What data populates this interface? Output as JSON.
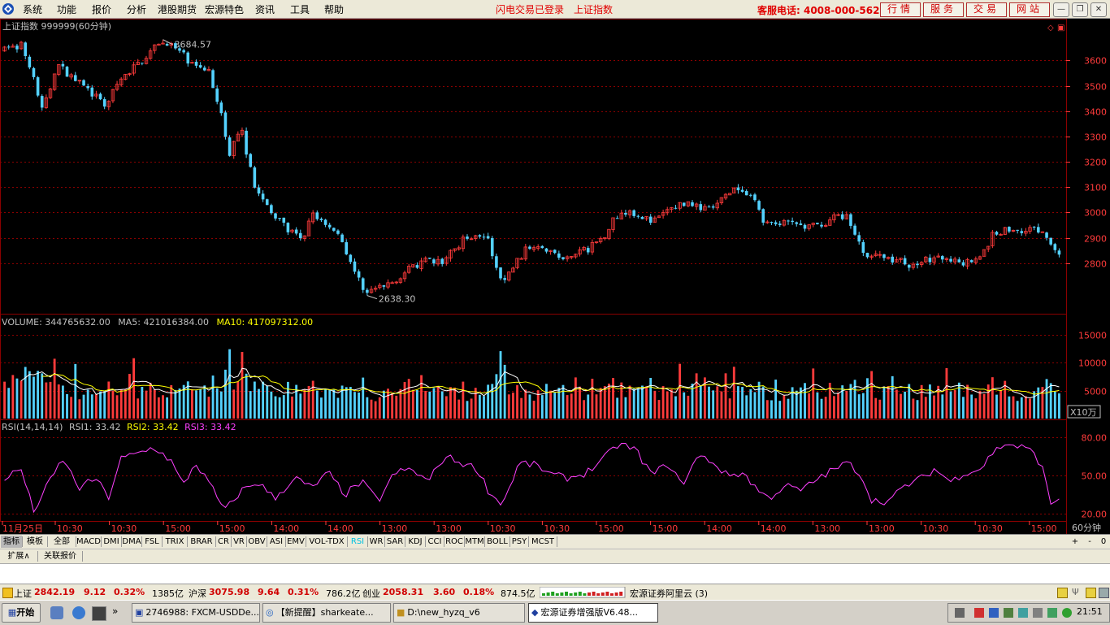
{
  "menu": {
    "items": [
      "系统",
      "功能",
      "报价",
      "分析",
      "港股期货",
      "宏源特色",
      "资讯",
      "工具",
      "帮助"
    ],
    "status_login": "闪电交易已登录",
    "status_index": "上证指数",
    "hotline": "客服电话: 4008-000-562",
    "buttons": [
      "行情",
      "服务",
      "交易",
      "网站"
    ],
    "window_controls": [
      "minimize-icon",
      "restore-icon",
      "close-icon"
    ]
  },
  "chart": {
    "header": "上证指数 999999(60分钟)",
    "high_label": "3684.57",
    "low_label": "2638.30",
    "volume_header": {
      "prefix": "VOLUME: 344765632.00",
      "ma5": "MA5: 421016384.00",
      "ma10": "MA10: 417097312.00"
    },
    "rsi_header": {
      "prefix": "RSI(14,14,14)",
      "rsi1": "RSI1: 33.42",
      "rsi2": "RSI2: 33.42",
      "rsi3": "RSI3: 33.42"
    },
    "volume_unit": "X10万",
    "period_label": "60分钟",
    "colors": {
      "up": "#ff3b3b",
      "down": "#54d2ff",
      "grid": "#8b0000",
      "ma5": "#ffffff",
      "ma10": "#ffff00",
      "rsi": "#ff40ff",
      "axis_text": "#ff3b3b"
    }
  },
  "chart_data": [
    {
      "type": "candlestick",
      "title": "上证指数 999999(60分钟)",
      "y_ticks": [
        2800,
        2900,
        3000,
        3100,
        3200,
        3300,
        3400,
        3500,
        3600
      ],
      "ylim": [
        2620,
        3710
      ],
      "high": 3684.57,
      "low": 2638.3,
      "trend_anchors": [
        [
          0,
          3640
        ],
        [
          8,
          3660
        ],
        [
          14,
          3540
        ],
        [
          18,
          3400
        ],
        [
          26,
          3580
        ],
        [
          33,
          3530
        ],
        [
          42,
          3470
        ],
        [
          48,
          3420
        ],
        [
          56,
          3520
        ],
        [
          66,
          3600
        ],
        [
          74,
          3660
        ],
        [
          78,
          3675
        ],
        [
          86,
          3620
        ],
        [
          92,
          3570
        ],
        [
          98,
          3570
        ],
        [
          104,
          3400
        ],
        [
          108,
          3230
        ],
        [
          114,
          3330
        ],
        [
          120,
          3110
        ],
        [
          128,
          3000
        ],
        [
          136,
          2940
        ],
        [
          144,
          2880
        ],
        [
          148,
          3000
        ],
        [
          154,
          2960
        ],
        [
          160,
          2930
        ],
        [
          164,
          2860
        ],
        [
          170,
          2740
        ],
        [
          174,
          2690
        ],
        [
          180,
          2700
        ],
        [
          186,
          2720
        ],
        [
          192,
          2760
        ],
        [
          198,
          2790
        ],
        [
          204,
          2810
        ],
        [
          210,
          2800
        ],
        [
          216,
          2850
        ],
        [
          222,
          2900
        ],
        [
          228,
          2920
        ],
        [
          233,
          2890
        ],
        [
          236,
          2790
        ],
        [
          240,
          2720
        ],
        [
          246,
          2800
        ],
        [
          252,
          2860
        ],
        [
          258,
          2880
        ],
        [
          264,
          2840
        ],
        [
          270,
          2810
        ],
        [
          276,
          2840
        ],
        [
          282,
          2860
        ],
        [
          288,
          2900
        ],
        [
          294,
          2980
        ],
        [
          300,
          3010
        ],
        [
          306,
          2990
        ],
        [
          312,
          2960
        ],
        [
          318,
          3000
        ],
        [
          324,
          3030
        ],
        [
          330,
          3040
        ],
        [
          336,
          3010
        ],
        [
          342,
          3020
        ],
        [
          348,
          3070
        ],
        [
          352,
          3090
        ],
        [
          356,
          3080
        ],
        [
          362,
          3040
        ],
        [
          366,
          2960
        ],
        [
          372,
          2950
        ],
        [
          380,
          2960
        ],
        [
          386,
          2940
        ],
        [
          392,
          2950
        ],
        [
          400,
          2980
        ],
        [
          406,
          2990
        ],
        [
          410,
          2900
        ],
        [
          414,
          2840
        ],
        [
          420,
          2830
        ],
        [
          426,
          2820
        ],
        [
          432,
          2810
        ],
        [
          436,
          2790
        ],
        [
          440,
          2800
        ],
        [
          446,
          2820
        ],
        [
          452,
          2810
        ],
        [
          458,
          2820
        ],
        [
          462,
          2800
        ],
        [
          468,
          2820
        ],
        [
          474,
          2860
        ],
        [
          476,
          2920
        ],
        [
          482,
          2930
        ],
        [
          488,
          2930
        ],
        [
          494,
          2940
        ],
        [
          500,
          2920
        ],
        [
          504,
          2880
        ],
        [
          508,
          2830
        ]
      ],
      "volume_y_ticks": [
        5000,
        10000,
        15000
      ],
      "volume_ylim": [
        0,
        16000
      ],
      "rsi_y_ticks": [
        20.0,
        50.0,
        80.0
      ],
      "rsi_ylim": [
        15,
        85
      ],
      "rsi_anchors": [
        [
          0,
          48
        ],
        [
          8,
          55
        ],
        [
          14,
          22
        ],
        [
          20,
          40
        ],
        [
          28,
          63
        ],
        [
          36,
          40
        ],
        [
          44,
          48
        ],
        [
          50,
          32
        ],
        [
          56,
          63
        ],
        [
          64,
          67
        ],
        [
          72,
          72
        ],
        [
          80,
          62
        ],
        [
          86,
          42
        ],
        [
          92,
          60
        ],
        [
          100,
          40
        ],
        [
          106,
          22
        ],
        [
          114,
          38
        ],
        [
          122,
          45
        ],
        [
          130,
          32
        ],
        [
          140,
          48
        ],
        [
          148,
          40
        ],
        [
          156,
          52
        ],
        [
          164,
          35
        ],
        [
          172,
          45
        ],
        [
          180,
          30
        ],
        [
          188,
          52
        ],
        [
          196,
          55
        ],
        [
          204,
          45
        ],
        [
          212,
          65
        ],
        [
          220,
          60
        ],
        [
          228,
          55
        ],
        [
          234,
          35
        ],
        [
          240,
          28
        ],
        [
          248,
          60
        ],
        [
          256,
          58
        ],
        [
          264,
          50
        ],
        [
          272,
          48
        ],
        [
          280,
          52
        ],
        [
          288,
          62
        ],
        [
          296,
          75
        ],
        [
          304,
          70
        ],
        [
          312,
          50
        ],
        [
          320,
          60
        ],
        [
          326,
          42
        ],
        [
          334,
          65
        ],
        [
          340,
          62
        ],
        [
          348,
          50
        ],
        [
          356,
          52
        ],
        [
          362,
          40
        ],
        [
          368,
          32
        ],
        [
          376,
          42
        ],
        [
          384,
          38
        ],
        [
          392,
          48
        ],
        [
          400,
          55
        ],
        [
          406,
          60
        ],
        [
          412,
          52
        ],
        [
          418,
          30
        ],
        [
          426,
          30
        ],
        [
          434,
          42
        ],
        [
          442,
          48
        ],
        [
          448,
          55
        ],
        [
          456,
          45
        ],
        [
          462,
          52
        ],
        [
          470,
          55
        ],
        [
          476,
          68
        ],
        [
          482,
          75
        ],
        [
          490,
          72
        ],
        [
          496,
          68
        ],
        [
          500,
          55
        ],
        [
          504,
          28
        ],
        [
          508,
          32
        ]
      ],
      "x_labels": [
        "11月25日",
        "10:30",
        "10:30",
        "15:00",
        "15:00",
        "14:00",
        "14:00",
        "13:00",
        "13:00",
        "10:30",
        "10:30",
        "15:00",
        "15:00",
        "14:00",
        "14:00",
        "13:00",
        "13:00",
        "10:30",
        "10:30",
        "15:00"
      ],
      "candle_count": 254
    }
  ],
  "tabs": {
    "items": [
      "指标",
      "模板",
      "全部",
      "MACD",
      "DMI",
      "DMA",
      "FSL",
      "TRIX",
      "BRAR",
      "CR",
      "VR",
      "OBV",
      "ASI",
      "EMV",
      "VOL-TDX",
      "RSI",
      "WR",
      "SAR",
      "KDJ",
      "CCI",
      "ROC",
      "MTM",
      "BOLL",
      "PSY",
      "MCST"
    ],
    "active": "RSI",
    "right_buttons": [
      "+",
      "-",
      "0"
    ]
  },
  "subtabs": {
    "items": [
      "扩展∧",
      "关联报价"
    ]
  },
  "statusbar": {
    "sh": {
      "name": "上证",
      "value": "2842.19",
      "change": "9.12",
      "pct": "0.32%",
      "amount": "1385亿"
    },
    "hs": {
      "name": "沪深",
      "value": "3075.98",
      "change": "9.64",
      "pct": "0.31%",
      "amount": "786.2亿"
    },
    "cy": {
      "name": "创业",
      "value": "2058.31",
      "change": "3.60",
      "pct": "0.18%",
      "amount": "874.5亿"
    },
    "server": "宏源证券阿里云 (3)"
  },
  "taskbar": {
    "start": "开始",
    "windows": [
      "2746988: FXCM-USDDe...",
      "【新提醒】sharkeate...",
      "D:\\new_hyzq_v6",
      "宏源证券增强版V6.48..."
    ],
    "active_window": 3,
    "clock": "21:51"
  }
}
